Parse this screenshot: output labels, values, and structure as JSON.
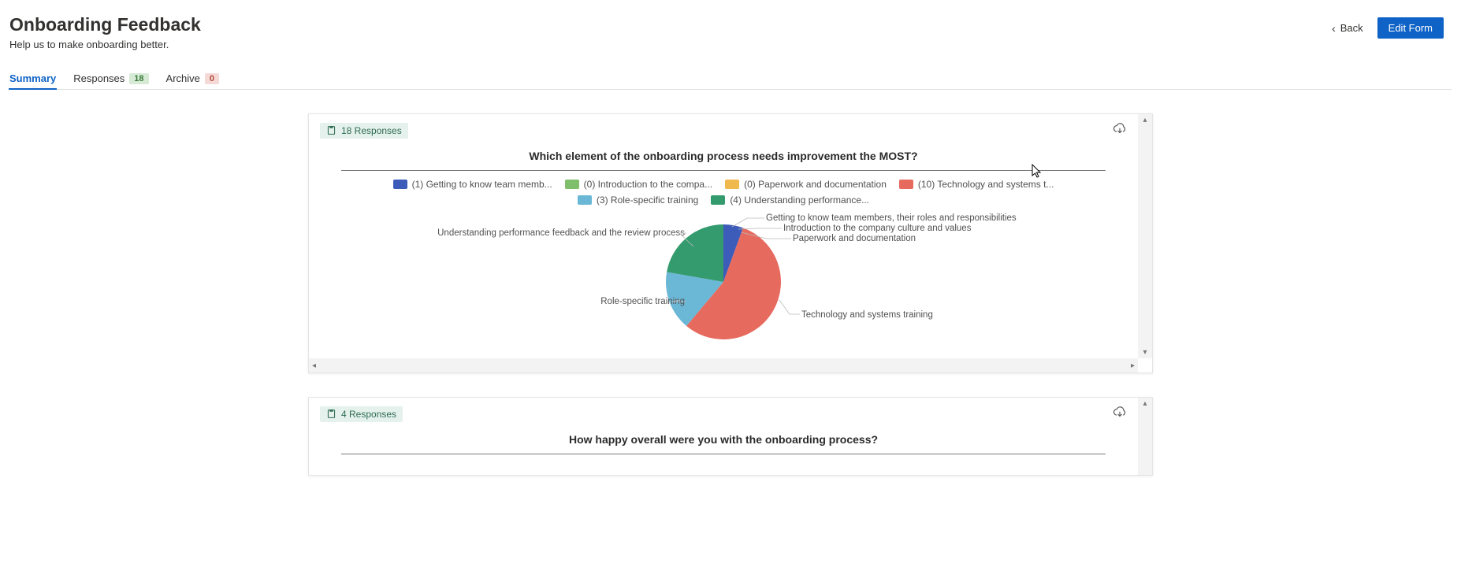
{
  "header": {
    "title": "Onboarding Feedback",
    "subtitle": "Help us to make onboarding better.",
    "back_label": "Back",
    "edit_label": "Edit Form"
  },
  "tabs": {
    "summary": "Summary",
    "responses": "Responses",
    "responses_count": "18",
    "archive": "Archive",
    "archive_count": "0"
  },
  "card1": {
    "responses_label": "18 Responses",
    "question": "Which element of the onboarding process needs improvement the MOST?"
  },
  "card2": {
    "responses_label": "4 Responses",
    "question": "How happy overall were you with the onboarding process?"
  },
  "chart_data": {
    "type": "pie",
    "title": "Which element of the onboarding process needs improvement the MOST?",
    "series": [
      {
        "name": "Getting to know team members, their roles and responsibilities",
        "legend": "(1) Getting to know team memb...",
        "value": 1,
        "color": "#3d5bb8"
      },
      {
        "name": "Introduction to the company culture and values",
        "legend": "(0) Introduction to the compa...",
        "value": 0,
        "color": "#7fbf6b"
      },
      {
        "name": "Paperwork and documentation",
        "legend": "(0) Paperwork and documentation",
        "value": 0,
        "color": "#f0b94d"
      },
      {
        "name": "Technology and systems training",
        "legend": "(10) Technology and systems t...",
        "value": 10,
        "color": "#e76a5f"
      },
      {
        "name": "Role-specific training",
        "legend": "(3) Role-specific training",
        "value": 3,
        "color": "#6bb7d6"
      },
      {
        "name": "Understanding performance feedback and the review process",
        "legend": "(4) Understanding performance...",
        "value": 4,
        "color": "#349b6e"
      }
    ],
    "total": 18
  },
  "callouts": {
    "c1": "Getting to know team members, their roles and responsibilities",
    "c2": "Introduction to the company culture and values",
    "c3": "Paperwork and documentation",
    "c4": "Technology and systems training",
    "c5": "Role-specific training",
    "c6": "Understanding performance feedback and the review process"
  },
  "chart_data_2": {
    "type": "unknown",
    "title": "How happy overall were you with the onboarding process?",
    "responses": 4
  }
}
